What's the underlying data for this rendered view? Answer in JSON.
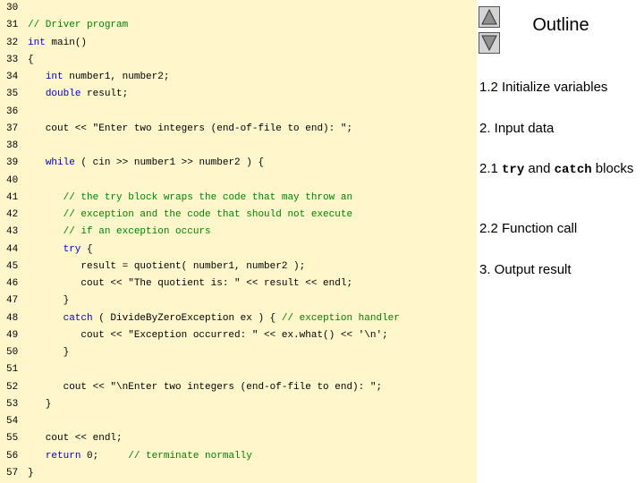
{
  "code": {
    "lines": [
      {
        "num": "30",
        "segments": []
      },
      {
        "num": "31",
        "segments": [
          {
            "t": "// Driver program",
            "c": "cm"
          }
        ]
      },
      {
        "num": "32",
        "segments": [
          {
            "t": "int",
            "c": "kw"
          },
          {
            "t": " main()",
            "c": ""
          }
        ]
      },
      {
        "num": "33",
        "segments": [
          {
            "t": "{",
            "c": ""
          }
        ]
      },
      {
        "num": "34",
        "segments": [
          {
            "t": "   ",
            "c": ""
          },
          {
            "t": "int",
            "c": "kw"
          },
          {
            "t": " number1, number2;",
            "c": ""
          }
        ]
      },
      {
        "num": "35",
        "segments": [
          {
            "t": "   ",
            "c": ""
          },
          {
            "t": "double",
            "c": "kw"
          },
          {
            "t": " result;",
            "c": ""
          }
        ]
      },
      {
        "num": "36",
        "segments": []
      },
      {
        "num": "37",
        "segments": [
          {
            "t": "   cout << \"Enter two integers (end-of-file to end): \";",
            "c": ""
          }
        ]
      },
      {
        "num": "38",
        "segments": []
      },
      {
        "num": "39",
        "segments": [
          {
            "t": "   ",
            "c": ""
          },
          {
            "t": "while",
            "c": "kw"
          },
          {
            "t": " ( cin >> number1 >> number2 ) {",
            "c": ""
          }
        ]
      },
      {
        "num": "40",
        "segments": []
      },
      {
        "num": "41",
        "segments": [
          {
            "t": "      ",
            "c": ""
          },
          {
            "t": "// the try block wraps the code that may throw an",
            "c": "cm"
          }
        ]
      },
      {
        "num": "42",
        "segments": [
          {
            "t": "      ",
            "c": ""
          },
          {
            "t": "// exception and the code that should not execute",
            "c": "cm"
          }
        ]
      },
      {
        "num": "43",
        "segments": [
          {
            "t": "      ",
            "c": ""
          },
          {
            "t": "// if an exception occurs",
            "c": "cm"
          }
        ]
      },
      {
        "num": "44",
        "segments": [
          {
            "t": "      ",
            "c": ""
          },
          {
            "t": "try",
            "c": "kw"
          },
          {
            "t": " {",
            "c": ""
          }
        ]
      },
      {
        "num": "45",
        "segments": [
          {
            "t": "         result = quotient( number1, number2 );",
            "c": ""
          }
        ]
      },
      {
        "num": "46",
        "segments": [
          {
            "t": "         cout << \"The quotient is: \" << result << endl;",
            "c": ""
          }
        ]
      },
      {
        "num": "47",
        "segments": [
          {
            "t": "      }",
            "c": ""
          }
        ]
      },
      {
        "num": "48",
        "segments": [
          {
            "t": "      ",
            "c": ""
          },
          {
            "t": "catch",
            "c": "kw"
          },
          {
            "t": " ( DivideByZeroException ex ) { ",
            "c": ""
          },
          {
            "t": "// exception handler",
            "c": "cm"
          }
        ]
      },
      {
        "num": "49",
        "segments": [
          {
            "t": "         cout << \"Exception occurred: \" << ex.what() << '\\n';",
            "c": ""
          }
        ]
      },
      {
        "num": "50",
        "segments": [
          {
            "t": "      }",
            "c": ""
          }
        ]
      },
      {
        "num": "51",
        "segments": []
      },
      {
        "num": "52",
        "segments": [
          {
            "t": "      cout << \"\\nEnter two integers (end-of-file to end): \";",
            "c": ""
          }
        ]
      },
      {
        "num": "53",
        "segments": [
          {
            "t": "   }",
            "c": ""
          }
        ]
      },
      {
        "num": "54",
        "segments": []
      },
      {
        "num": "55",
        "segments": [
          {
            "t": "   cout << endl;",
            "c": ""
          }
        ]
      },
      {
        "num": "56",
        "segments": [
          {
            "t": "   ",
            "c": ""
          },
          {
            "t": "return",
            "c": "kw"
          },
          {
            "t": " 0;     ",
            "c": ""
          },
          {
            "t": "// terminate normally",
            "c": "cm"
          }
        ]
      },
      {
        "num": "57",
        "segments": [
          {
            "t": "}",
            "c": ""
          }
        ]
      }
    ]
  },
  "outline": {
    "title": "Outline",
    "nav_up_icon": "triangle-up-icon",
    "nav_down_icon": "triangle-down-icon",
    "items": [
      {
        "parts": [
          {
            "t": "1.2 Initialize variables",
            "mono": false
          }
        ]
      },
      {
        "parts": [
          {
            "t": "2. Input data",
            "mono": false
          }
        ]
      },
      {
        "parts": [
          {
            "t": "2.1 ",
            "mono": false
          },
          {
            "t": "try",
            "mono": true
          },
          {
            "t": " and ",
            "mono": false
          },
          {
            "t": "catch",
            "mono": true
          },
          {
            "t": " blocks",
            "mono": false
          }
        ]
      },
      {
        "parts": [
          {
            "t": "2.2 Function call",
            "mono": false
          }
        ]
      },
      {
        "parts": [
          {
            "t": "3. Output result",
            "mono": false
          }
        ]
      }
    ]
  },
  "colors": {
    "code_background": "#fff6cc",
    "keyword": "#0000cc",
    "comment": "#008000",
    "text": "#000000"
  }
}
